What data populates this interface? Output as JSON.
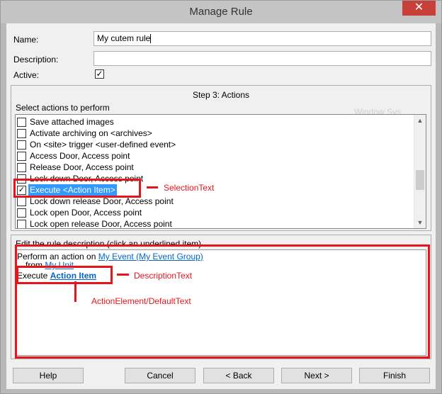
{
  "window": {
    "title": "Manage Rule",
    "close_glyph": "✕"
  },
  "form": {
    "name_label": "Name:",
    "name_value": "My cutem rule",
    "description_label": "Description:",
    "description_value": "",
    "active_label": "Active:",
    "active_checked": true
  },
  "step": {
    "title": "Step 3: Actions"
  },
  "actions": {
    "label": "Select actions to perform",
    "items": [
      {
        "label": "Save attached images",
        "checked": false
      },
      {
        "label": "Activate archiving on <archives>",
        "checked": false
      },
      {
        "label": "On <site> trigger <user-defined event>",
        "checked": false
      },
      {
        "label": "Access Door, Access point",
        "checked": false
      },
      {
        "label": "Release Door, Access point",
        "checked": false
      },
      {
        "label": "Lock down Door, Access point",
        "checked": false
      },
      {
        "label": "Execute <Action Item>",
        "checked": true,
        "selected": true
      },
      {
        "label": "Lock down release Door, Access point",
        "checked": false
      },
      {
        "label": "Lock open Door, Access point",
        "checked": false
      },
      {
        "label": "Lock open release Door, Access point",
        "checked": false
      }
    ],
    "ghost_text": "Window  Sys"
  },
  "description_panel": {
    "label": "Edit the rule description (click an underlined item)",
    "line1_prefix": "Perform an action on",
    "line1_link": "My Event (My Event Group)",
    "line2_prefix": "from",
    "line2_link": "My Unit",
    "line3_prefix": "Execute",
    "line3_link": "Action Item"
  },
  "annotations": {
    "selection": "SelectionText",
    "description": "DescriptionText",
    "element": "ActionElement/DefaultText",
    "color": "#e8141b"
  },
  "buttons": {
    "help": "Help",
    "cancel": "Cancel",
    "back": "< Back",
    "next": "Next >",
    "finish": "Finish"
  }
}
